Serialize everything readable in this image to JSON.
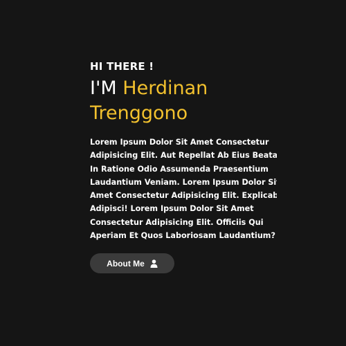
{
  "hero": {
    "greeting": "HI THERE !",
    "name_prefix": "I'M",
    "first_name": "Herdinan",
    "last_name": "Trenggono",
    "description_lines": [
      "Lorem Ipsum Dolor Sit Amet Consectetur",
      "Adipisicing Elit. Aut Repellat Ab Eius Beatae",
      "In Ratione Odio Assumenda Praesentium",
      "Laudantium Veniam. Lorem Ipsum Dolor Sit",
      "Amet Consectetur Adipisicing Elit. Explicabo",
      "Adipisci! Lorem Ipsum Dolor Sit Amet",
      "Consectetur Adipisicing Elit. Officiis Qui",
      "Aperiam Et Quos Laboriosam Laudantium?"
    ]
  },
  "about_button": {
    "label": "About Me",
    "icon": "user-icon"
  },
  "colors": {
    "background": "#151515",
    "accent": "#f2c12e",
    "text": "#ffffff",
    "button_bg": "#3b3b3b"
  }
}
